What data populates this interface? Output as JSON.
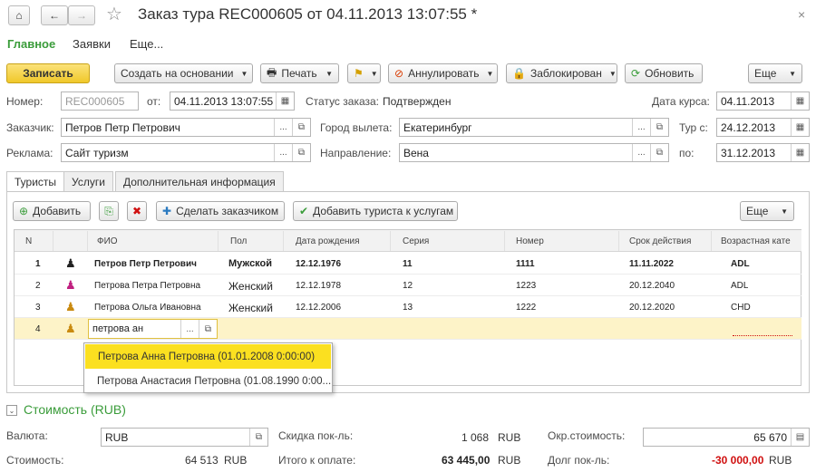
{
  "window": {
    "title": "Заказ тура REC000605 от 04.11.2013 13:07:55 *",
    "close": "×"
  },
  "nav": {
    "home": "⌂",
    "back": "←",
    "forward": "→",
    "star": "☆"
  },
  "sections": [
    "Главное",
    "Заявки",
    "Еще..."
  ],
  "toolbar": {
    "write": "Записать",
    "create_based": "Создать на основании",
    "print": "Печать",
    "annul": "Аннулировать",
    "blocked": "Заблокирован",
    "refresh": "Обновить",
    "more": "Еще"
  },
  "form": {
    "number_label": "Номер:",
    "number": "REC000605",
    "from_label": "от:",
    "date": "04.11.2013 13:07:55",
    "status_label": "Статус заказа:",
    "status": "Подтвержден",
    "rate_date_label": "Дата курса:",
    "rate_date": "04.11.2013",
    "customer_label": "Заказчик:",
    "customer": "Петров Петр Петрович",
    "city_label": "Город вылета:",
    "city": "Екатеринбург",
    "tour_from_label": "Тур с:",
    "tour_from": "24.12.2013",
    "ad_label": "Реклама:",
    "ad": "Сайт туризм",
    "direction_label": "Направление:",
    "direction": "Вена",
    "to_label": "по:",
    "tour_to": "31.12.2013"
  },
  "tabs": [
    "Туристы",
    "Услуги",
    "Дополнительная информация"
  ],
  "tourists_toolbar": {
    "add": "Добавить",
    "make_customer": "Сделать заказчиком",
    "add_to_services": "Добавить туриста к услугам",
    "more": "Еще"
  },
  "table": {
    "columns": [
      "N",
      "ФИО",
      "Пол",
      "Дата рождения",
      "Серия",
      "Номер",
      "Срок действия",
      "Возрастная кате"
    ],
    "rows": [
      {
        "n": "1",
        "fio": "Петров Петр Петрович",
        "sex": "Мужской",
        "birth": "12.12.1976",
        "series": "11",
        "number": "1111",
        "valid": "11.11.2022",
        "age": "ADL",
        "icon": "male",
        "bold": true
      },
      {
        "n": "2",
        "fio": "Петрова Петра Петровна",
        "sex": "Женский",
        "birth": "12.12.1978",
        "series": "12",
        "number": "1223",
        "valid": "20.12.2040",
        "age": "ADL",
        "icon": "female",
        "bold": false
      },
      {
        "n": "3",
        "fio": "Петрова Ольга Ивановна",
        "sex": "Женский",
        "birth": "12.12.2006",
        "series": "13",
        "number": "1222",
        "valid": "20.12.2020",
        "age": "CHD",
        "icon": "child",
        "bold": false
      }
    ],
    "edit_row": {
      "n": "4",
      "input": "петрова ан"
    }
  },
  "dropdown": [
    "Петрова Анна Петровна (01.01.2008 0:00:00)",
    "Петрова Анастасия Петровна (01.08.1990 0:00..."
  ],
  "cost": {
    "title": "Стоимость (RUB)",
    "currency_label": "Валюта:",
    "currency": "RUB",
    "discount_label": "Скидка пок-ль:",
    "discount": "1 068",
    "discount_cur": "RUB",
    "round_label": "Окр.стоимость:",
    "round": "65 670",
    "cost_label": "Стоимость:",
    "cost": "64 513",
    "cost_cur": "RUB",
    "total_label": "Итого к оплате:",
    "total": "63 445,00",
    "total_cur": "RUB",
    "debt_label": "Долг пок-ль:",
    "debt": "-30 000,00",
    "debt_cur": "RUB"
  },
  "colors": {
    "accent_yellow": "#f5d23a",
    "green": "#3a9c3a",
    "red": "#d01010",
    "selected": "#fbe46a",
    "edit_row": "#fdf3c8"
  }
}
